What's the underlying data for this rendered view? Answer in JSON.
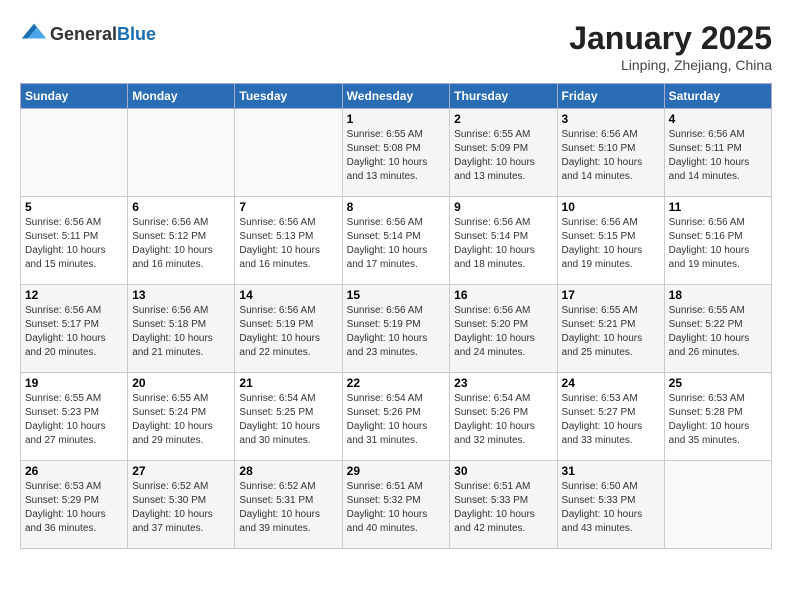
{
  "header": {
    "logo_general": "General",
    "logo_blue": "Blue",
    "month_title": "January 2025",
    "location": "Linping, Zhejiang, China"
  },
  "weekdays": [
    "Sunday",
    "Monday",
    "Tuesday",
    "Wednesday",
    "Thursday",
    "Friday",
    "Saturday"
  ],
  "weeks": [
    [
      {
        "day": "",
        "info": ""
      },
      {
        "day": "",
        "info": ""
      },
      {
        "day": "",
        "info": ""
      },
      {
        "day": "1",
        "info": "Sunrise: 6:55 AM\nSunset: 5:08 PM\nDaylight: 10 hours\nand 13 minutes."
      },
      {
        "day": "2",
        "info": "Sunrise: 6:55 AM\nSunset: 5:09 PM\nDaylight: 10 hours\nand 13 minutes."
      },
      {
        "day": "3",
        "info": "Sunrise: 6:56 AM\nSunset: 5:10 PM\nDaylight: 10 hours\nand 14 minutes."
      },
      {
        "day": "4",
        "info": "Sunrise: 6:56 AM\nSunset: 5:11 PM\nDaylight: 10 hours\nand 14 minutes."
      }
    ],
    [
      {
        "day": "5",
        "info": "Sunrise: 6:56 AM\nSunset: 5:11 PM\nDaylight: 10 hours\nand 15 minutes."
      },
      {
        "day": "6",
        "info": "Sunrise: 6:56 AM\nSunset: 5:12 PM\nDaylight: 10 hours\nand 16 minutes."
      },
      {
        "day": "7",
        "info": "Sunrise: 6:56 AM\nSunset: 5:13 PM\nDaylight: 10 hours\nand 16 minutes."
      },
      {
        "day": "8",
        "info": "Sunrise: 6:56 AM\nSunset: 5:14 PM\nDaylight: 10 hours\nand 17 minutes."
      },
      {
        "day": "9",
        "info": "Sunrise: 6:56 AM\nSunset: 5:14 PM\nDaylight: 10 hours\nand 18 minutes."
      },
      {
        "day": "10",
        "info": "Sunrise: 6:56 AM\nSunset: 5:15 PM\nDaylight: 10 hours\nand 19 minutes."
      },
      {
        "day": "11",
        "info": "Sunrise: 6:56 AM\nSunset: 5:16 PM\nDaylight: 10 hours\nand 19 minutes."
      }
    ],
    [
      {
        "day": "12",
        "info": "Sunrise: 6:56 AM\nSunset: 5:17 PM\nDaylight: 10 hours\nand 20 minutes."
      },
      {
        "day": "13",
        "info": "Sunrise: 6:56 AM\nSunset: 5:18 PM\nDaylight: 10 hours\nand 21 minutes."
      },
      {
        "day": "14",
        "info": "Sunrise: 6:56 AM\nSunset: 5:19 PM\nDaylight: 10 hours\nand 22 minutes."
      },
      {
        "day": "15",
        "info": "Sunrise: 6:56 AM\nSunset: 5:19 PM\nDaylight: 10 hours\nand 23 minutes."
      },
      {
        "day": "16",
        "info": "Sunrise: 6:56 AM\nSunset: 5:20 PM\nDaylight: 10 hours\nand 24 minutes."
      },
      {
        "day": "17",
        "info": "Sunrise: 6:55 AM\nSunset: 5:21 PM\nDaylight: 10 hours\nand 25 minutes."
      },
      {
        "day": "18",
        "info": "Sunrise: 6:55 AM\nSunset: 5:22 PM\nDaylight: 10 hours\nand 26 minutes."
      }
    ],
    [
      {
        "day": "19",
        "info": "Sunrise: 6:55 AM\nSunset: 5:23 PM\nDaylight: 10 hours\nand 27 minutes."
      },
      {
        "day": "20",
        "info": "Sunrise: 6:55 AM\nSunset: 5:24 PM\nDaylight: 10 hours\nand 29 minutes."
      },
      {
        "day": "21",
        "info": "Sunrise: 6:54 AM\nSunset: 5:25 PM\nDaylight: 10 hours\nand 30 minutes."
      },
      {
        "day": "22",
        "info": "Sunrise: 6:54 AM\nSunset: 5:26 PM\nDaylight: 10 hours\nand 31 minutes."
      },
      {
        "day": "23",
        "info": "Sunrise: 6:54 AM\nSunset: 5:26 PM\nDaylight: 10 hours\nand 32 minutes."
      },
      {
        "day": "24",
        "info": "Sunrise: 6:53 AM\nSunset: 5:27 PM\nDaylight: 10 hours\nand 33 minutes."
      },
      {
        "day": "25",
        "info": "Sunrise: 6:53 AM\nSunset: 5:28 PM\nDaylight: 10 hours\nand 35 minutes."
      }
    ],
    [
      {
        "day": "26",
        "info": "Sunrise: 6:53 AM\nSunset: 5:29 PM\nDaylight: 10 hours\nand 36 minutes."
      },
      {
        "day": "27",
        "info": "Sunrise: 6:52 AM\nSunset: 5:30 PM\nDaylight: 10 hours\nand 37 minutes."
      },
      {
        "day": "28",
        "info": "Sunrise: 6:52 AM\nSunset: 5:31 PM\nDaylight: 10 hours\nand 39 minutes."
      },
      {
        "day": "29",
        "info": "Sunrise: 6:51 AM\nSunset: 5:32 PM\nDaylight: 10 hours\nand 40 minutes."
      },
      {
        "day": "30",
        "info": "Sunrise: 6:51 AM\nSunset: 5:33 PM\nDaylight: 10 hours\nand 42 minutes."
      },
      {
        "day": "31",
        "info": "Sunrise: 6:50 AM\nSunset: 5:33 PM\nDaylight: 10 hours\nand 43 minutes."
      },
      {
        "day": "",
        "info": ""
      }
    ]
  ]
}
